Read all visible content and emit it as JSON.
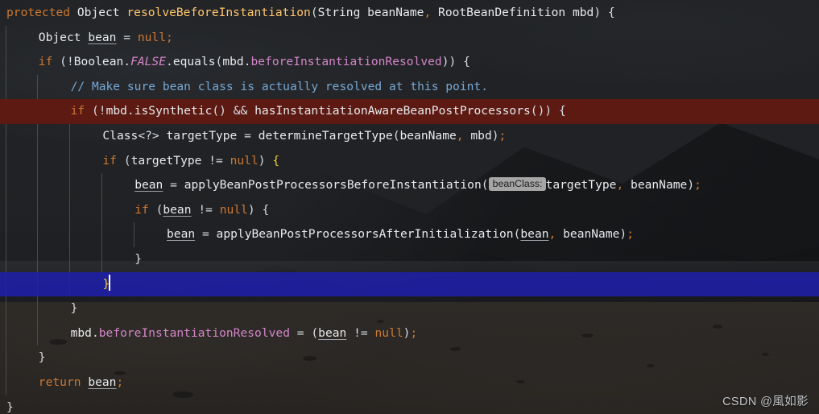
{
  "app": {
    "kind": "code-editor",
    "theme": "darcula-dark-with-background-image",
    "language": "Java"
  },
  "colors": {
    "editor_background": "#232527",
    "default_text": "#a9b7c6",
    "keyword_orange": "#cc7832",
    "method_yellow": "#ffc66d",
    "field_violet": "#d486c9",
    "comment_blue": "#76a8d4",
    "plain_white": "#e8eaed",
    "highlight_line_red": "#5c1a12",
    "selected_line_blue": "#1f1fa8",
    "matched_brace_yellow": "#f2d12b",
    "param_hint_background": "#a6a6a6",
    "param_hint_text": "#1d1d1d",
    "indent_guide": "#5a5a5a",
    "caret": "#ffffff",
    "watermark_text": "#cfd2d6"
  },
  "editor": {
    "caret_line_index": 9,
    "highlighted_line_index": 4,
    "indent_guide_x": [
      7,
      46,
      86,
      126,
      166
    ],
    "param_hint": {
      "label": "beanClass:",
      "line_index": 6
    },
    "plain_source": "protected Object resolveBeforeInstantiation(String beanName, RootBeanDefinition mbd) {\n    Object bean = null;\n    if (!Boolean.FALSE.equals(mbd.beforeInstantiationResolved)) {\n        // Make sure bean class is actually resolved at this point.\n        if (!mbd.isSynthetic() && hasInstantiationAwareBeanPostProcessors()) {\n            Class<?> targetType = determineTargetType(beanName, mbd);\n            if (targetType != null) {\n                bean = applyBeanPostProcessorsBeforeInstantiation(targetType, beanName);\n                if (bean != null) {\n                    bean = applyBeanPostProcessorsAfterInitialization(bean, beanName);\n                }\n            }\n        }\n        mbd.beforeInstantiationResolved = (bean != null);\n    }\n    return bean;\n}",
    "lines": [
      {
        "index": 0,
        "indent": 0,
        "state": "normal",
        "tokens": [
          {
            "t": "protected",
            "c": "kw"
          },
          {
            "t": " ",
            "c": "op"
          },
          {
            "t": "Object",
            "c": "type"
          },
          {
            "t": " ",
            "c": "op"
          },
          {
            "t": "resolveBeforeInstantiation",
            "c": "mth"
          },
          {
            "t": "(",
            "c": "brc"
          },
          {
            "t": "String",
            "c": "type"
          },
          {
            "t": " beanName",
            "c": "type"
          },
          {
            "t": ",",
            "c": "sc"
          },
          {
            "t": " ",
            "c": "op"
          },
          {
            "t": "RootBeanDefinition",
            "c": "type"
          },
          {
            "t": " mbd",
            "c": "type"
          },
          {
            "t": ")",
            "c": "brc"
          },
          {
            "t": " ",
            "c": "op"
          },
          {
            "t": "{",
            "c": "brc"
          }
        ]
      },
      {
        "index": 1,
        "indent": 1,
        "state": "normal",
        "tokens": [
          {
            "t": "Object",
            "c": "type"
          },
          {
            "t": " ",
            "c": "op"
          },
          {
            "t": "bean",
            "c": "loc"
          },
          {
            "t": " ",
            "c": "op"
          },
          {
            "t": "=",
            "c": "op"
          },
          {
            "t": " ",
            "c": "op"
          },
          {
            "t": "null",
            "c": "kw"
          },
          {
            "t": ";",
            "c": "sc"
          }
        ]
      },
      {
        "index": 2,
        "indent": 1,
        "state": "normal",
        "tokens": [
          {
            "t": "if",
            "c": "kw"
          },
          {
            "t": " ",
            "c": "op"
          },
          {
            "t": "(",
            "c": "brc"
          },
          {
            "t": "!",
            "c": "op"
          },
          {
            "t": "Boolean",
            "c": "type"
          },
          {
            "t": ".",
            "c": "pun"
          },
          {
            "t": "FALSE",
            "c": "fldi"
          },
          {
            "t": ".",
            "c": "pun"
          },
          {
            "t": "equals",
            "c": "type"
          },
          {
            "t": "(",
            "c": "brc"
          },
          {
            "t": "mbd",
            "c": "type"
          },
          {
            "t": ".",
            "c": "pun"
          },
          {
            "t": "beforeInstantiationResolved",
            "c": "fld"
          },
          {
            "t": "))",
            "c": "brc"
          },
          {
            "t": " ",
            "c": "op"
          },
          {
            "t": "{",
            "c": "brc"
          }
        ]
      },
      {
        "index": 3,
        "indent": 2,
        "state": "normal",
        "tokens": [
          {
            "t": "// Make sure bean class is actually resolved at this point.",
            "c": "cmt"
          }
        ]
      },
      {
        "index": 4,
        "indent": 2,
        "state": "highlight-red",
        "tokens": [
          {
            "t": "if",
            "c": "kw"
          },
          {
            "t": " ",
            "c": "op"
          },
          {
            "t": "(",
            "c": "brc"
          },
          {
            "t": "!",
            "c": "op"
          },
          {
            "t": "mbd",
            "c": "type"
          },
          {
            "t": ".",
            "c": "pun"
          },
          {
            "t": "isSynthetic",
            "c": "type"
          },
          {
            "t": "()",
            "c": "brc"
          },
          {
            "t": " ",
            "c": "op"
          },
          {
            "t": "&&",
            "c": "op"
          },
          {
            "t": " ",
            "c": "op"
          },
          {
            "t": "hasInstantiationAwareBeanPostProcessors",
            "c": "type"
          },
          {
            "t": "())",
            "c": "brc"
          },
          {
            "t": " ",
            "c": "op"
          },
          {
            "t": "{",
            "c": "brc"
          }
        ]
      },
      {
        "index": 5,
        "indent": 3,
        "state": "normal",
        "tokens": [
          {
            "t": "Class",
            "c": "type"
          },
          {
            "t": "<?>",
            "c": "op"
          },
          {
            "t": " ",
            "c": "op"
          },
          {
            "t": "targetType",
            "c": "type"
          },
          {
            "t": " ",
            "c": "op"
          },
          {
            "t": "=",
            "c": "op"
          },
          {
            "t": " ",
            "c": "op"
          },
          {
            "t": "determineTargetType",
            "c": "type"
          },
          {
            "t": "(",
            "c": "brc"
          },
          {
            "t": "beanName",
            "c": "type"
          },
          {
            "t": ",",
            "c": "sc"
          },
          {
            "t": " ",
            "c": "op"
          },
          {
            "t": "mbd",
            "c": "type"
          },
          {
            "t": ")",
            "c": "brc"
          },
          {
            "t": ";",
            "c": "sc"
          }
        ]
      },
      {
        "index": 6,
        "indent": 3,
        "state": "normal",
        "tokens": [
          {
            "t": "if",
            "c": "kw"
          },
          {
            "t": " ",
            "c": "op"
          },
          {
            "t": "(",
            "c": "brc"
          },
          {
            "t": "targetType",
            "c": "type"
          },
          {
            "t": " ",
            "c": "op"
          },
          {
            "t": "!=",
            "c": "op"
          },
          {
            "t": " ",
            "c": "op"
          },
          {
            "t": "null",
            "c": "kw"
          },
          {
            "t": ")",
            "c": "brc"
          },
          {
            "t": " ",
            "c": "op"
          },
          {
            "t": "{",
            "c": "brcm"
          }
        ]
      },
      {
        "index": 7,
        "indent": 4,
        "state": "normal",
        "has_hint": true,
        "tokens": [
          {
            "t": "bean",
            "c": "loc"
          },
          {
            "t": " ",
            "c": "op"
          },
          {
            "t": "=",
            "c": "op"
          },
          {
            "t": " ",
            "c": "op"
          },
          {
            "t": "applyBeanPostProcessorsBeforeInstantiation",
            "c": "type"
          },
          {
            "t": "(",
            "c": "brc"
          },
          {
            "t": "beanClass:",
            "c": "hint"
          },
          {
            "t": "targetType",
            "c": "type"
          },
          {
            "t": ",",
            "c": "sc"
          },
          {
            "t": " ",
            "c": "op"
          },
          {
            "t": "beanName",
            "c": "type"
          },
          {
            "t": ")",
            "c": "brc"
          },
          {
            "t": ";",
            "c": "sc"
          }
        ]
      },
      {
        "index": 8,
        "indent": 4,
        "state": "normal",
        "tokens": [
          {
            "t": "if",
            "c": "kw"
          },
          {
            "t": " ",
            "c": "op"
          },
          {
            "t": "(",
            "c": "brc"
          },
          {
            "t": "bean",
            "c": "loc"
          },
          {
            "t": " ",
            "c": "op"
          },
          {
            "t": "!=",
            "c": "op"
          },
          {
            "t": " ",
            "c": "op"
          },
          {
            "t": "null",
            "c": "kw"
          },
          {
            "t": ")",
            "c": "brc"
          },
          {
            "t": " ",
            "c": "op"
          },
          {
            "t": "{",
            "c": "brc"
          }
        ]
      },
      {
        "index": 9,
        "indent": 5,
        "state": "normal",
        "tokens": [
          {
            "t": "bean",
            "c": "loc"
          },
          {
            "t": " ",
            "c": "op"
          },
          {
            "t": "=",
            "c": "op"
          },
          {
            "t": " ",
            "c": "op"
          },
          {
            "t": "applyBeanPostProcessorsAfterInitialization",
            "c": "type"
          },
          {
            "t": "(",
            "c": "brc"
          },
          {
            "t": "bean",
            "c": "loc"
          },
          {
            "t": ",",
            "c": "sc"
          },
          {
            "t": " ",
            "c": "op"
          },
          {
            "t": "beanName",
            "c": "type"
          },
          {
            "t": ")",
            "c": "brc"
          },
          {
            "t": ";",
            "c": "sc"
          }
        ]
      },
      {
        "index": 10,
        "indent": 4,
        "state": "normal",
        "tokens": [
          {
            "t": "}",
            "c": "brc"
          }
        ]
      },
      {
        "index": 11,
        "indent": 3,
        "state": "selected-blue",
        "caret_after": true,
        "tokens": [
          {
            "t": "}",
            "c": "brcm"
          }
        ]
      },
      {
        "index": 12,
        "indent": 2,
        "state": "normal",
        "tokens": [
          {
            "t": "}",
            "c": "brc"
          }
        ]
      },
      {
        "index": 13,
        "indent": 2,
        "state": "normal",
        "tokens": [
          {
            "t": "mbd",
            "c": "type"
          },
          {
            "t": ".",
            "c": "pun"
          },
          {
            "t": "beforeInstantiationResolved",
            "c": "fld"
          },
          {
            "t": " ",
            "c": "op"
          },
          {
            "t": "=",
            "c": "op"
          },
          {
            "t": " ",
            "c": "op"
          },
          {
            "t": "(",
            "c": "brc"
          },
          {
            "t": "bean",
            "c": "loc"
          },
          {
            "t": " ",
            "c": "op"
          },
          {
            "t": "!=",
            "c": "op"
          },
          {
            "t": " ",
            "c": "op"
          },
          {
            "t": "null",
            "c": "kw"
          },
          {
            "t": ")",
            "c": "brc"
          },
          {
            "t": ";",
            "c": "sc"
          }
        ]
      },
      {
        "index": 14,
        "indent": 1,
        "state": "normal",
        "tokens": [
          {
            "t": "}",
            "c": "brc"
          }
        ]
      },
      {
        "index": 15,
        "indent": 1,
        "state": "normal",
        "tokens": [
          {
            "t": "return",
            "c": "kw"
          },
          {
            "t": " ",
            "c": "op"
          },
          {
            "t": "bean",
            "c": "loc"
          },
          {
            "t": ";",
            "c": "sc"
          }
        ]
      },
      {
        "index": 16,
        "indent": 0,
        "state": "normal",
        "tokens": [
          {
            "t": "}",
            "c": "brc"
          }
        ]
      }
    ]
  },
  "watermark": {
    "text": "CSDN @風如影"
  }
}
